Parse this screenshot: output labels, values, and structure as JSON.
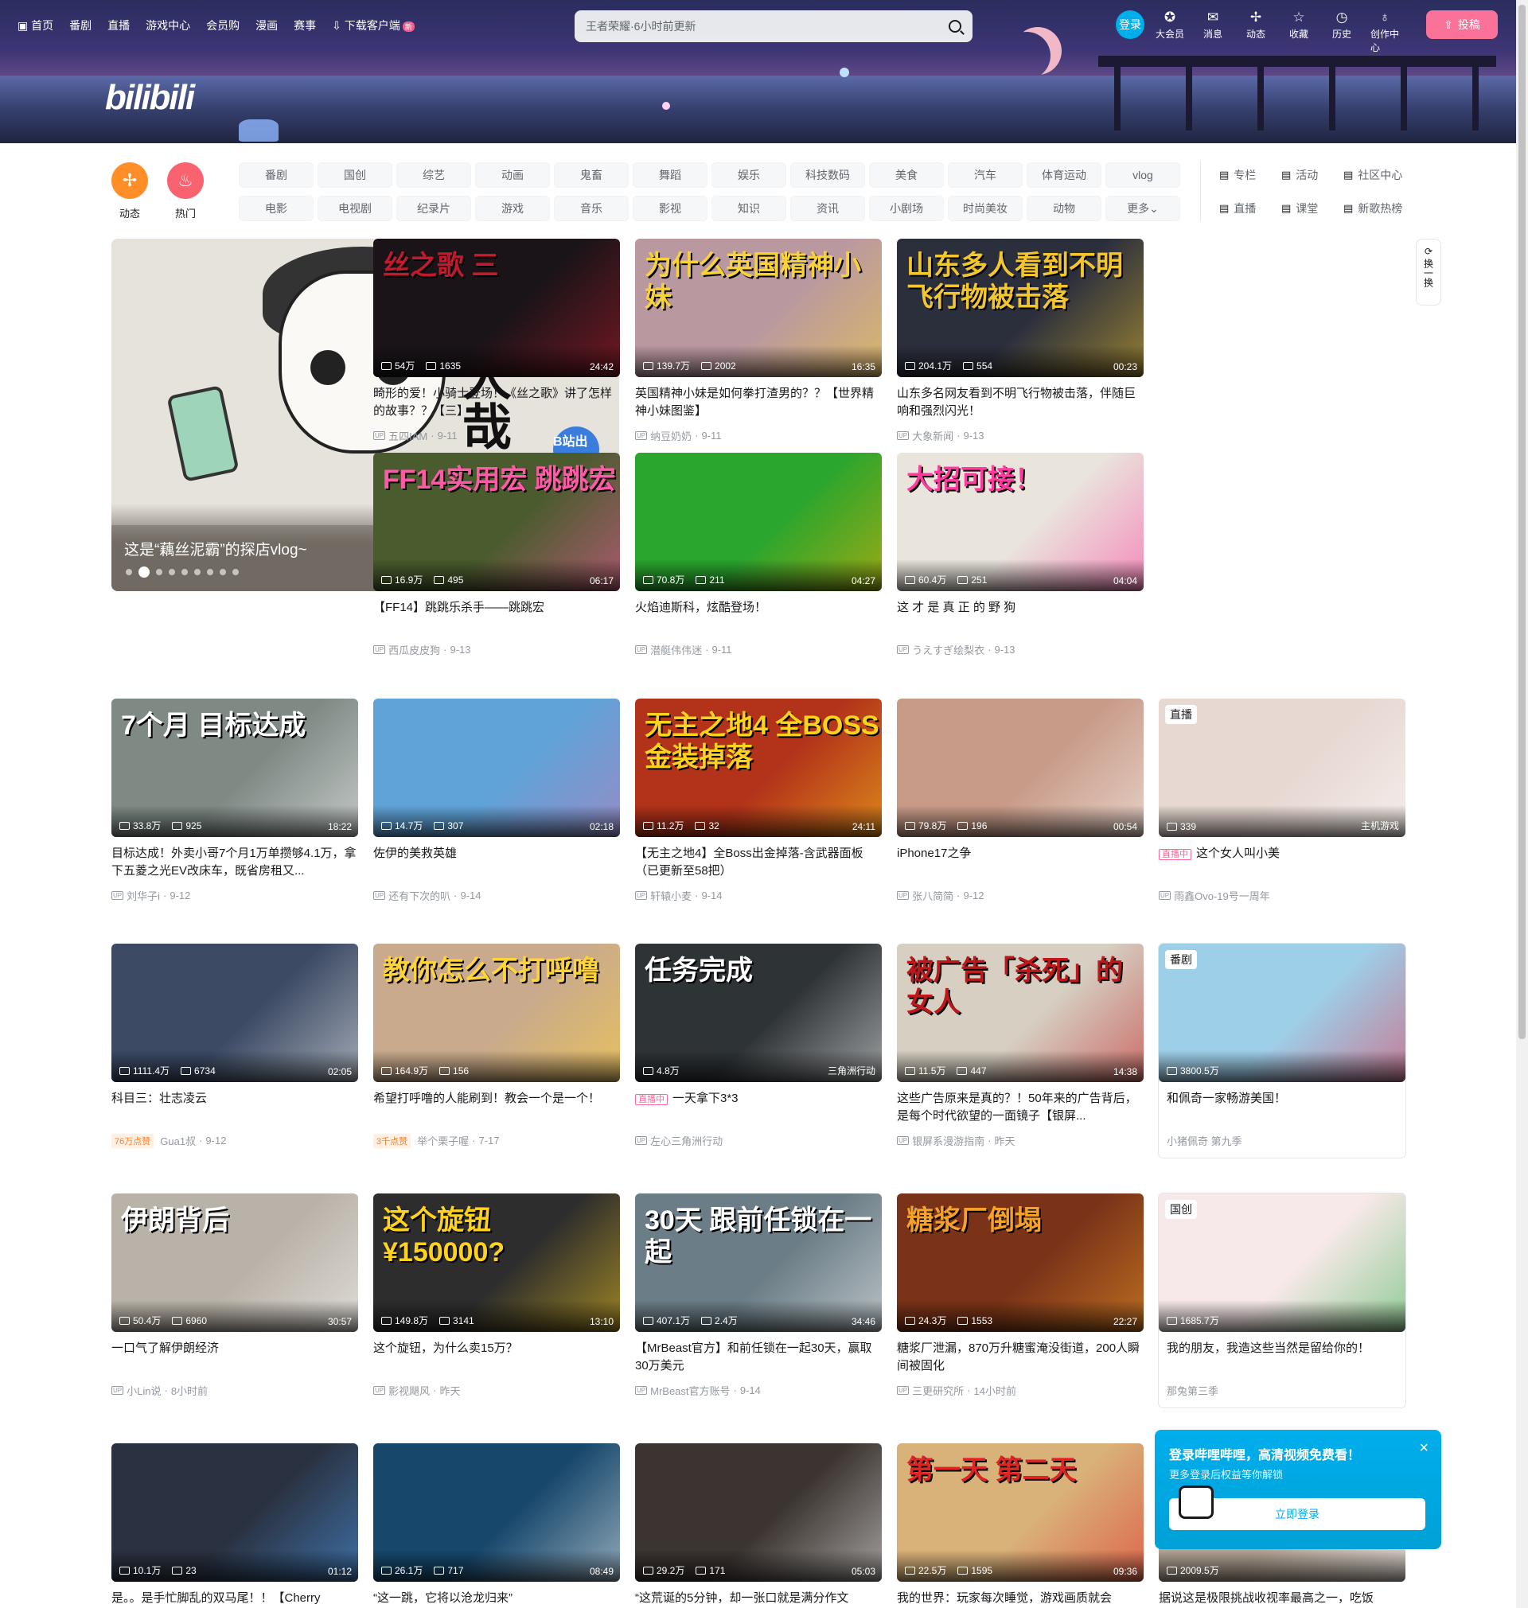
{
  "header": {
    "nav": [
      {
        "label": "首页",
        "icon": "tv-icon"
      },
      {
        "label": "番剧"
      },
      {
        "label": "直播"
      },
      {
        "label": "游戏中心"
      },
      {
        "label": "会员购"
      },
      {
        "label": "漫画"
      },
      {
        "label": "赛事"
      },
      {
        "label": "下载客户端",
        "icon": "download-icon",
        "badge": "新"
      }
    ],
    "logo_text": "bilibili",
    "search_placeholder": "王者荣耀·6小时前更新",
    "login_label": "登录",
    "right_nav": [
      {
        "label": "大会员",
        "icon": "vip-icon",
        "glyph": "✪"
      },
      {
        "label": "消息",
        "icon": "message-icon",
        "glyph": "✉"
      },
      {
        "label": "动态",
        "icon": "dynamic-icon",
        "glyph": "✢"
      },
      {
        "label": "收藏",
        "icon": "favorite-icon",
        "glyph": "☆"
      },
      {
        "label": "历史",
        "icon": "history-icon",
        "glyph": "◷"
      },
      {
        "label": "创作中心",
        "icon": "creator-icon",
        "glyph": "♁"
      }
    ],
    "upload_label": "投稿"
  },
  "channels": {
    "circles": [
      {
        "label": "动态",
        "color": "#ff8e29",
        "glyph": "✢"
      },
      {
        "label": "热门",
        "color": "#f9626f",
        "glyph": "♨"
      }
    ],
    "row1": [
      "番剧",
      "国创",
      "综艺",
      "动画",
      "鬼畜",
      "舞蹈",
      "娱乐",
      "科技数码",
      "美食",
      "汽车",
      "体育运动",
      "vlog"
    ],
    "row2": [
      "电影",
      "电视剧",
      "纪录片",
      "游戏",
      "音乐",
      "影视",
      "知识",
      "资讯",
      "小剧场",
      "时尚美妆",
      "动物",
      "更多"
    ],
    "side": [
      {
        "label": "专栏",
        "icon": "column-icon"
      },
      {
        "label": "活动",
        "icon": "activity-icon"
      },
      {
        "label": "社区中心",
        "icon": "community-icon"
      },
      {
        "label": "直播",
        "icon": "live-icon"
      },
      {
        "label": "课堂",
        "icon": "classroom-icon"
      },
      {
        "label": "新歌热榜",
        "icon": "music-chart-icon"
      }
    ]
  },
  "carousel": {
    "caption": "这是“藕丝泥霸”的探店vlog~",
    "art_text": "非人哉",
    "badge_text": "B站出品",
    "slide_count": 9,
    "active_index": 1
  },
  "refresh_label": "换一换",
  "videos": [
    {
      "title": "畸形的爱！小骑士登场！《丝之歌》讲了怎样的故事？？【三】",
      "views": "54万",
      "danmaku": "1635",
      "duration": "24:42",
      "author": "五四IAM",
      "date": "9-11",
      "thumb_text": "丝之歌 三",
      "bg": "#1a1418",
      "accent": "#c01b2c"
    },
    {
      "title": "英国精神小妹是如何拳打渣男的？？【世界精神小妹图鉴】",
      "views": "139.7万",
      "danmaku": "2002",
      "duration": "16:35",
      "author": "纳豆奶奶",
      "date": "9-11",
      "thumb_text": "为什么英国精神小妹",
      "bg": "#b998a0",
      "accent": "#f7d23a"
    },
    {
      "title": "山东多名网友看到不明飞行物被击落，伴随巨响和强烈闪光！",
      "views": "204.1万",
      "danmaku": "554",
      "duration": "00:23",
      "author": "大象新闻",
      "date": "9-13",
      "thumb_text": "山东多人看到不明飞行物被击落",
      "bg": "#2b2f3c",
      "accent": "#f4c62d"
    },
    {
      "title": "【FF14】跳跳乐杀手——跳跳宏",
      "views": "16.9万",
      "danmaku": "495",
      "duration": "06:17",
      "author": "西瓜皮皮狗",
      "date": "9-13",
      "thumb_text": "FF14实用宏 跳跳宏",
      "bg": "#4a5b2e",
      "accent": "#ff5aa8"
    },
    {
      "title": "火焰迪斯科，炫酷登场！",
      "views": "70.8万",
      "danmaku": "211",
      "duration": "04:27",
      "author": "潜艇伟伟迷",
      "date": "9-11",
      "thumb_text": "",
      "bg": "#2aa52e",
      "accent": "#ffae00"
    },
    {
      "title": "这 才 是 真 正 的 野 狗",
      "views": "60.4万",
      "danmaku": "251",
      "duration": "04:04",
      "author": "うえすぎ绘梨衣",
      "date": "9-13",
      "thumb_text": "大招可接！",
      "bg": "#e9e4dc",
      "accent": "#ff3aa0"
    },
    {
      "title": "目标达成！外卖小哥7个月1万单攒够4.1万，拿下五菱之光EV改床车，既省房租又...",
      "views": "33.8万",
      "danmaku": "925",
      "duration": "18:22",
      "author": "刘华子i",
      "date": "9-12",
      "thumb_text": "7个月 目标达成",
      "bg": "#7f8a85",
      "accent": "#fff"
    },
    {
      "title": "佐伊的美救英雄",
      "views": "14.7万",
      "danmaku": "307",
      "duration": "02:18",
      "author": "还有下次的叭",
      "date": "9-14",
      "thumb_text": "",
      "bg": "#5fa3d8",
      "accent": "#c47ab5"
    },
    {
      "title": "【无主之地4】全Boss出金掉落-含武器面板（已更新至58把）",
      "views": "11.2万",
      "danmaku": "32",
      "duration": "24:11",
      "author": "轩辕小麦",
      "date": "9-14",
      "thumb_text": "无主之地4 全BOSS金装掉落",
      "bg": "#b3321a",
      "accent": "#ffd21d"
    },
    {
      "title": "iPhone17之争",
      "views": "79.8万",
      "danmaku": "196",
      "duration": "00:54",
      "author": "张八简简",
      "date": "9-12",
      "thumb_text": "",
      "bg": "#c89b88",
      "accent": "#fff"
    },
    {
      "live": true,
      "title": "这个女人叫小美",
      "views": "339",
      "category": "主机游戏",
      "badge": "直播",
      "live_tag": "直播中",
      "author": "雨鑫Ovo-19号一周年",
      "bg": "#e7d8d2",
      "accent": "#fff"
    },
    {
      "title": "科目三：壮志凌云",
      "views": "1111.4万",
      "danmaku": "6734",
      "duration": "02:05",
      "author": "Gua1叔",
      "date": "9-12",
      "hot": "76万点赞",
      "thumb_text": "",
      "bg": "#3c4a64",
      "accent": "#fff"
    },
    {
      "title": "希望打呼噜的人能刷到！教会一个是一个！",
      "views": "164.9万",
      "danmaku": "156",
      "duration": "",
      "author": "举个栗子喔",
      "date": "7-17",
      "hot": "3千点赞",
      "thumb_text": "教你怎么不打呼噜",
      "bg": "#c9aa8c",
      "accent": "#ffd33a"
    },
    {
      "live": true,
      "title": "一天拿下3*3",
      "views": "4.8万",
      "category": "三角洲行动",
      "live_tag": "直播中",
      "author": "左心三角洲行动",
      "thumb_text": "任务完成",
      "bg": "#2e3336",
      "accent": "#fff"
    },
    {
      "title": "这些广告原来是真的？！50年来的广告背后，是每个时代欲望的一面镜子【银屏...",
      "views": "11.5万",
      "danmaku": "447",
      "duration": "14:38",
      "author": "银屏系漫游指南",
      "date": "昨天",
      "thumb_text": "被广告「杀死」的女人",
      "bg": "#d6cfc2",
      "accent": "#c0181a"
    },
    {
      "special": true,
      "title": "和佩奇一家畅游美国！",
      "views": "3800.5万",
      "badge": "番剧",
      "subtitle": "小猪佩奇 第九季",
      "bg": "#9ecfe9",
      "accent": "#e8334a"
    },
    {
      "title": "一口气了解伊朗经济",
      "views": "50.4万",
      "danmaku": "6960",
      "duration": "30:57",
      "author": "小Lin说",
      "date": "8小时前",
      "thumb_text": "伊朗背后",
      "bg": "#b9b2a8",
      "accent": "#fff"
    },
    {
      "title": "这个旋钮，为什么卖15万？",
      "views": "149.8万",
      "danmaku": "3141",
      "duration": "13:10",
      "author": "影视飓风",
      "date": "昨天",
      "thumb_text": "这个旋钮 ¥150000?",
      "bg": "#2d2d2d",
      "accent": "#ffd21d"
    },
    {
      "title": "【MrBeast官方】和前任锁在一起30天，赢取30万美元",
      "views": "407.1万",
      "danmaku": "2.4万",
      "duration": "34:46",
      "author": "MrBeast官方账号",
      "date": "9-14",
      "thumb_text": "30天 跟前任锁在一起",
      "bg": "#6b7d86",
      "accent": "#fff"
    },
    {
      "title": "糖浆厂泄漏，870万升糖蜜淹没街道，200人瞬间被固化",
      "views": "24.3万",
      "danmaku": "1553",
      "duration": "22:27",
      "author": "三更研究所",
      "date": "14小时前",
      "thumb_text": "糖浆厂倒塌",
      "bg": "#7a3318",
      "accent": "#f5a12a"
    },
    {
      "special": true,
      "title": "我的朋友，我造这些当然是留给你的！",
      "views": "1685.7万",
      "badge": "国创",
      "subtitle": "那兔第三季",
      "bg": "#f7e9e9",
      "accent": "#38b04a"
    },
    {
      "title": "是。。是手忙脚乱的双马尾！！【Cherry",
      "views": "10.1万",
      "danmaku": "23",
      "duration": "01:12",
      "author": "",
      "date": "",
      "thumb_text": "",
      "bg": "#2a3140",
      "accent": "#4fa7ff"
    },
    {
      "title": "“这一跳，它将以沧龙归来”",
      "views": "26.1万",
      "danmaku": "717",
      "duration": "08:49",
      "author": "",
      "date": "",
      "thumb_text": "",
      "bg": "#17476b",
      "accent": "#fff"
    },
    {
      "title": "“这荒诞的5分钟，却一张口就是满分作文",
      "views": "29.2万",
      "danmaku": "171",
      "duration": "05:03",
      "author": "",
      "date": "",
      "thumb_text": "",
      "bg": "#3b3430",
      "accent": "#fff"
    },
    {
      "title": "我的世界：玩家每次睡觉，游戏画质就会",
      "views": "22.5万",
      "danmaku": "1595",
      "duration": "09:36",
      "author": "",
      "date": "",
      "thumb_text": "第一天 第二天",
      "bg": "#d9b27a",
      "accent": "#e02323"
    },
    {
      "title": "据说这是极限挑战收视率最高之一，吃饭",
      "views": "2009.5万",
      "danmaku": "",
      "duration": "",
      "author": "",
      "date": "",
      "thumb_text": "",
      "bg": "#b4a496",
      "accent": "#fff"
    }
  ],
  "login_popup": {
    "title": "登录哔哩哔哩，高清视频免费看！",
    "subtitle": "更多登录后权益等你解锁",
    "button": "立即登录"
  }
}
